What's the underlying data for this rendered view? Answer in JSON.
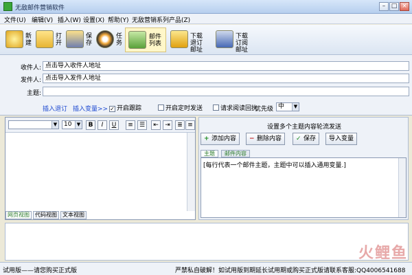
{
  "window": {
    "title": "无敌邮件营销软件"
  },
  "menu": [
    "文件(U)",
    "编辑(V)",
    "插入(W)",
    "设置(X)",
    "帮助(Y)",
    "无敌营销系列产品(Z)"
  ],
  "toolbar": {
    "new": "新建",
    "open": "打开",
    "save": "保存",
    "task": "任务",
    "mail_list": "邮件列表",
    "download_unsub": "下载退订邮址",
    "download_sub": "下载订阅邮址"
  },
  "fields": {
    "recipient_label": "收件人:",
    "recipient_value": "点击导入收件人地址",
    "sender_label": "发件人:",
    "sender_value": "点击导入发件人地址",
    "subject_label": "主题:",
    "subject_value": ""
  },
  "options": {
    "insert_unsub": "插入退订",
    "insert_var": "插入变量>>",
    "tracking": "开启跟踪",
    "tracking_checked": true,
    "timed_send": "开启定时发送",
    "read_receipt": "请求阅读回执",
    "priority_label": "优先级",
    "priority_value": "中"
  },
  "editor": {
    "font_size": "10",
    "format_buttons": [
      "B",
      "I",
      "U",
      "≡",
      "☰",
      "⇤",
      "⇥",
      "≣",
      "≡"
    ],
    "view_tabs": [
      "网页视图",
      "代码视图",
      "文本视图"
    ],
    "active_view": 0
  },
  "right_panel": {
    "heading": "设置多个主题内容轮流发送",
    "add_btn": "添加内容",
    "delete_btn": "删除内容",
    "save_btn": "保存",
    "import_var_btn": "导入变量",
    "tab_subject": "主题",
    "tab_content": "邮件内容",
    "subject_hint": "[每行代表一个邮件主题，主题中可以插入通用变量.]"
  },
  "status": {
    "left": "试用版——请您购买正式版",
    "right": "严禁私自破解！如试用版到期延长试用期或购买正式版请联系客服:QQ4006541688"
  },
  "watermark": "火鲤鱼"
}
